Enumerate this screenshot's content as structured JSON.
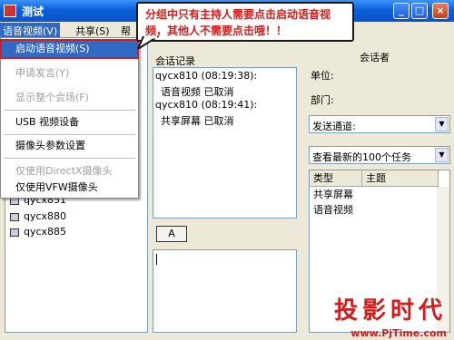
{
  "window": {
    "title": "测试"
  },
  "window_controls": {
    "minimize": "_",
    "maximize": "□",
    "close": "×"
  },
  "menu": {
    "items": [
      "语音视频(V)",
      "共享(S)",
      "帮"
    ],
    "active_index": 0
  },
  "dropdown": {
    "items": [
      {
        "label": "启动语音视频(S)",
        "state": "selected"
      },
      {
        "label": "申请发言(Y)",
        "state": "disabled"
      },
      {
        "label": "显示整个会场(F)",
        "state": "disabled"
      },
      {
        "label": "USB 视频设备",
        "state": "enabled"
      },
      {
        "label": "摄像头参数设置",
        "state": "enabled"
      },
      {
        "label": "仅使用DirectX摄像头",
        "state": "disabled"
      },
      {
        "label": "仅使用VFW摄像头",
        "state": "enabled"
      }
    ]
  },
  "users": [
    "qycx851",
    "qycx880",
    "qycx885"
  ],
  "chat": {
    "label": "会话记录",
    "lines": [
      "qycx810 (08:19:38):",
      " 语音视频  已取消",
      "qycx810 (08:19:41):",
      " 共享屏幕  已取消"
    ]
  },
  "font_button": "A",
  "speaker_panel": {
    "title": "会话者",
    "unit_label": "单位:",
    "dept_label": "部门:",
    "channel_select": "发送通道:",
    "task_filter_select": "查看最新的100个任务"
  },
  "task_table": {
    "columns": [
      "类型",
      "主题"
    ],
    "rows": [
      [
        "共享屏幕",
        ""
      ],
      [
        "语音视频",
        ""
      ]
    ]
  },
  "callout": {
    "text": "分组中只有主持人需要点击启动语音视频，其他人不需要点击哦！！"
  },
  "watermark": {
    "name": "投影时代",
    "url": "www.PjTime.com"
  },
  "colors": {
    "titlebar": "#0b5fd8",
    "menu_highlight": "#316ac5",
    "callout_text": "#d41c1c",
    "panel": "#ece9d8"
  }
}
